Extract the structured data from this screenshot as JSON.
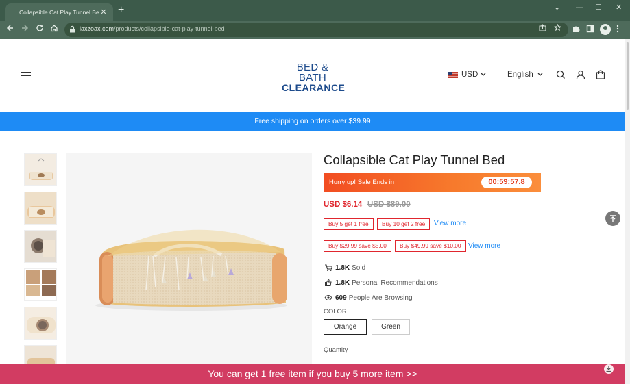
{
  "browser": {
    "tab_title": "Collapsible Cat Play Tunnel Bed",
    "url_domain": "laxzoax.com",
    "url_path": "/products/collapsible-cat-play-tunnel-bed",
    "new_tab": "+",
    "close_tab": "✕",
    "win_min": "—",
    "win_max": "☐",
    "win_close": "✕",
    "chevron": "⌄"
  },
  "header": {
    "logo_line1": "BED & BATH",
    "logo_line2": "CLEARANCE",
    "currency": "USD",
    "language": "English"
  },
  "announcement": "Free shipping on orders over $39.99",
  "product": {
    "title": "Collapsible Cat Play Tunnel Bed",
    "sale_label": "Hurry up! Sale Ends in",
    "timer": "00:59:57.8",
    "price": "USD $6.14",
    "old_price": "USD $89.00",
    "promos_row1": [
      "Buy 5 get 1 free",
      "Buy 10 get 2 free"
    ],
    "promos_row2": [
      "Buy $29.99 save $5.00",
      "Buy $49.99 save $10.00"
    ],
    "view_more": "View more",
    "sold_count": "1.8K",
    "sold_label": "Sold",
    "recommend_count": "1.8K",
    "recommend_label": "Personal Recommendations",
    "browsing_count": "609",
    "browsing_label": "People Are Browsing",
    "color_label": "COLOR",
    "colors": [
      "Orange",
      "Green"
    ],
    "selected_color": "Orange",
    "quantity_label": "Quantity"
  },
  "free_item_banner": "You can get 1 free item if you buy 5 more item  >>",
  "icons": {
    "tab_favicon": "globe-icon",
    "back": "back-arrow-icon",
    "forward": "forward-arrow-icon",
    "reload": "reload-icon",
    "home": "home-icon",
    "lock": "lock-icon",
    "share": "share-icon",
    "star": "star-icon",
    "extensions": "puzzle-icon",
    "sidepanel": "sidepanel-icon",
    "profile": "profile-icon",
    "menu_dots": "kebab-menu-icon",
    "hamburger": "hamburger-menu-icon",
    "search": "search-icon",
    "account": "user-icon",
    "cart": "shopping-bag-icon",
    "cart_small": "cart-icon",
    "thumbs_up": "thumbs-up-icon",
    "eye": "eye-icon",
    "back_to_top": "arrow-up-icon",
    "chat": "chat-icon"
  },
  "colors_theme": {
    "chrome_dark": "#3c5a4a",
    "chrome_mid": "#4e6b5b",
    "ship_bar": "#1e8bf5",
    "sale_red": "#e0262e",
    "free_bar": "#d23c62",
    "logo_blue": "#1d4b8c"
  }
}
